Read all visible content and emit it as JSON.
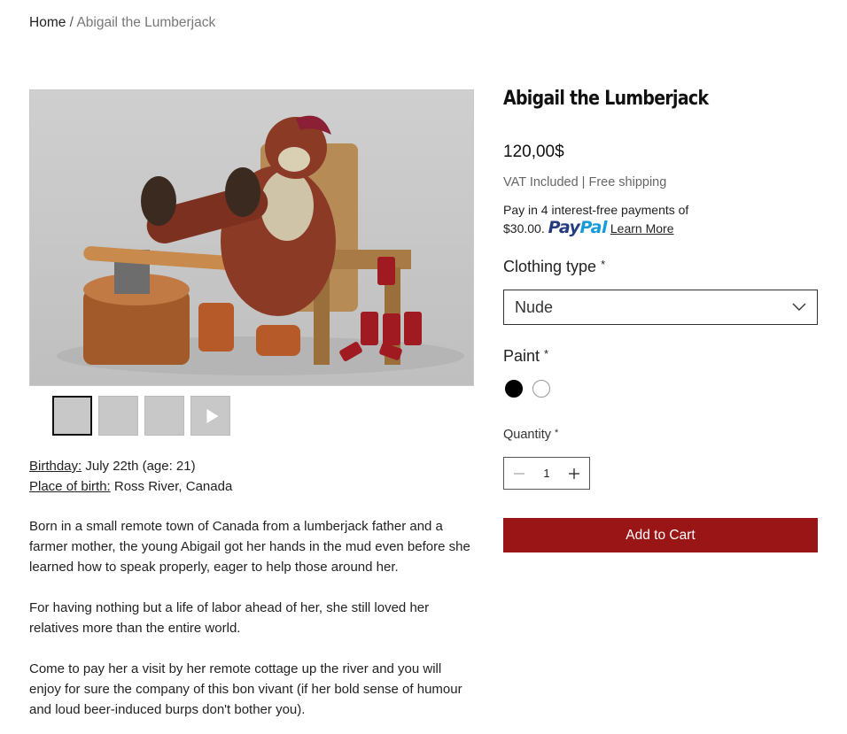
{
  "breadcrumb": {
    "home": "Home",
    "separator": "/",
    "current": "Abigail the Lumberjack"
  },
  "gallery": {
    "thumbnails": [
      {
        "icon": "image",
        "selected": true
      },
      {
        "icon": "image",
        "selected": false
      },
      {
        "icon": "image",
        "selected": false
      },
      {
        "icon": "video-play",
        "selected": false
      }
    ]
  },
  "facts": {
    "birthday_label": "Birthday:",
    "birthday_value": " July 22th (age: 21)",
    "birthplace_label": "Place of birth:",
    "birthplace_value": " Ross River, Canada"
  },
  "description": [
    "Born in a small remote town of Canada from a lumberjack father and a farmer mother, the young Abigail got her hands in the mud even before she learned how to speak properly, eager to help those around her.",
    "For having nothing but a life of labor ahead of her, she still loved her relatives more than the entire world.",
    "Come to pay her a visit by her remote cottage up the river and you will enjoy for sure the company of this bon vivant (if her bold sense of humour and loud beer-induced burps don't bother you)."
  ],
  "product": {
    "title": "Abigail the Lumberjack",
    "price": "120,00$",
    "vat_note": "VAT Included | Free shipping",
    "paypal_line1": "Pay in 4 interest-free payments of",
    "paypal_amount": "$30.00.",
    "paypal_logo_pay": "Pay",
    "paypal_logo_pal": "Pal",
    "learn_more": "Learn More"
  },
  "options": {
    "clothing_label": "Clothing type",
    "clothing_value": "Nude",
    "paint_label": "Paint",
    "required_mark": "*",
    "paint_swatches": [
      "#000000",
      "#ffffff"
    ]
  },
  "quantity": {
    "label": "Quantity",
    "value": "1"
  },
  "cart": {
    "add_label": "Add to Cart",
    "color": "#9a1515"
  }
}
